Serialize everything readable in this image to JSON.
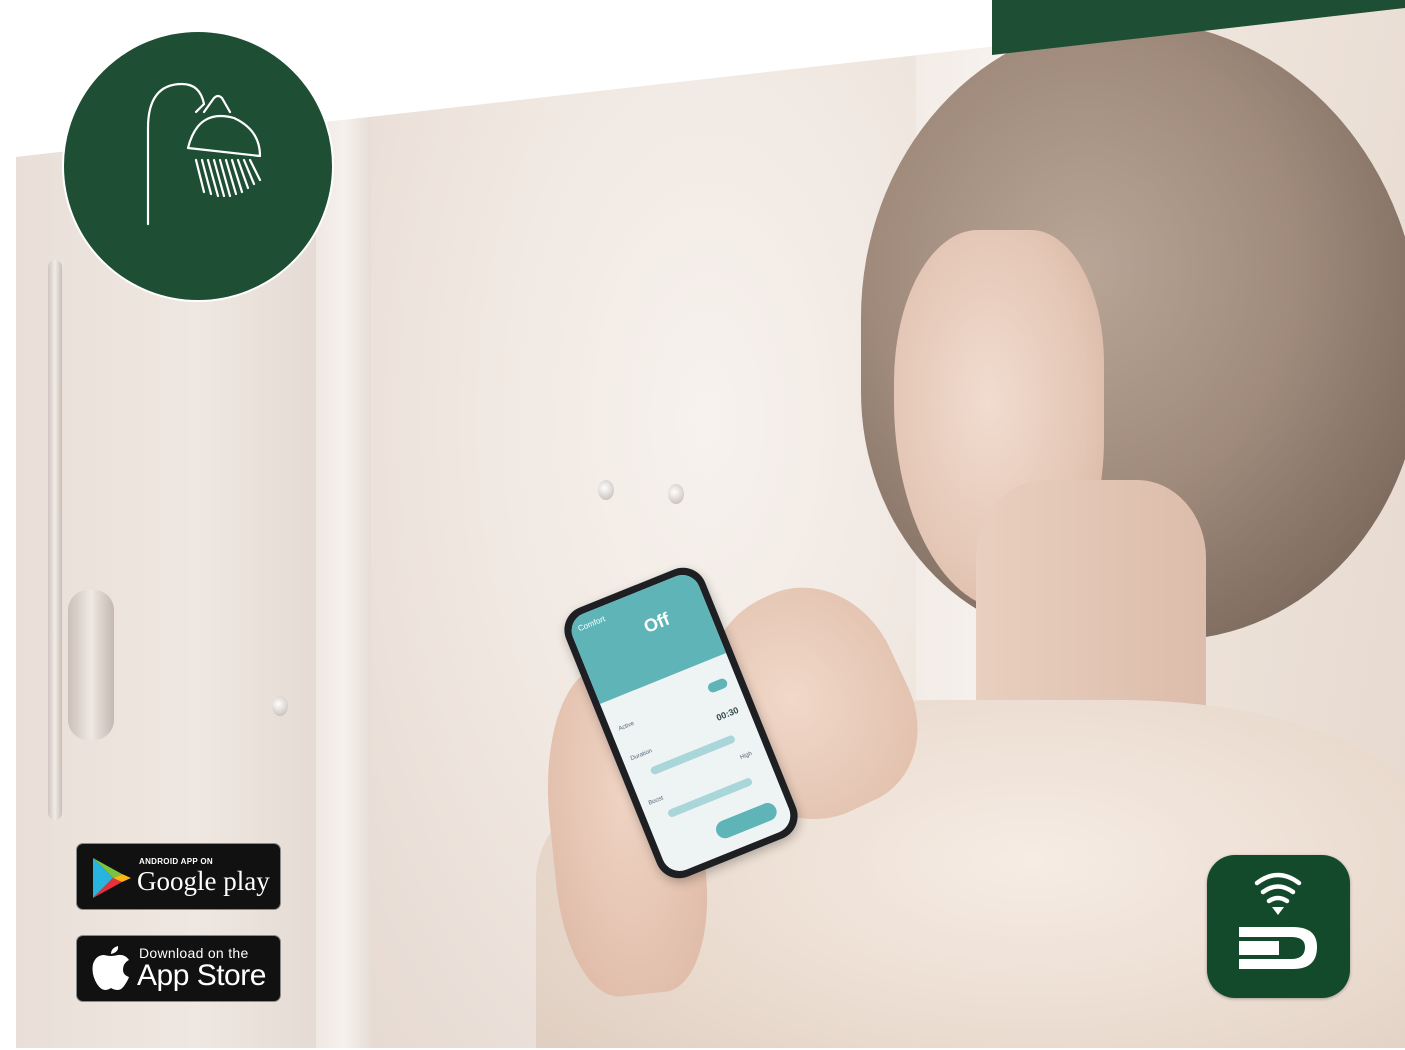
{
  "background": {
    "brand_color": "#1e4f35",
    "page_color": "#ffffff"
  },
  "hero_icon": {
    "icon": "shower-icon"
  },
  "phone_screen": {
    "mode": "Comfort",
    "status": "Off",
    "rows": [
      "Active",
      "Duration",
      "Boost"
    ],
    "duration_value": "00:30",
    "boost_level": "High"
  },
  "store_badges": {
    "google": {
      "small_text": "ANDROID APP ON",
      "big_text": "Google play",
      "icon": "play-triangle-icon"
    },
    "apple": {
      "small_text": "Download on the",
      "big_text": "App Store",
      "icon": "apple-icon"
    }
  },
  "app_icon": {
    "icon": "wifi-d-logo-icon",
    "color": "#134a2c"
  }
}
